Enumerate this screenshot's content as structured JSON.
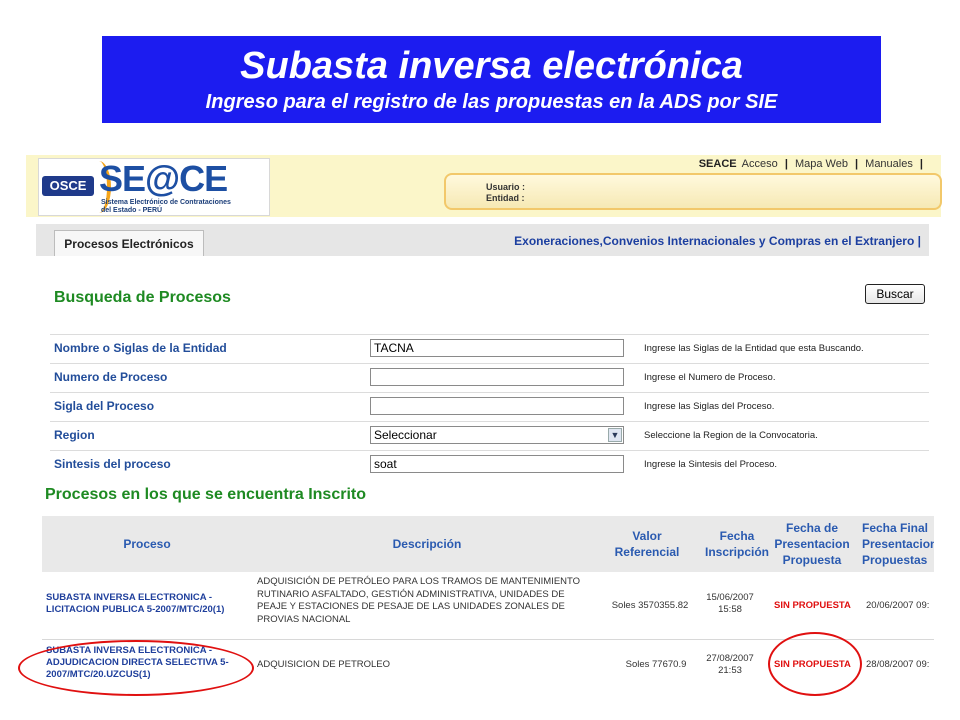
{
  "banner": {
    "title": "Subasta inversa electrónica",
    "subtitle": "Ingreso para el registro de las propuestas en la ADS por SIE"
  },
  "header": {
    "logo_osce": "OSCE",
    "logo_main": "SE@CE",
    "logo_sub_line1": "Sistema Electrónico de Contrataciones",
    "logo_sub_line2": "del Estado - PERÚ",
    "top_links": {
      "seace": "SEACE",
      "acceso": "Acceso",
      "mapa": "Mapa Web",
      "manuales": "Manuales",
      "sep": "|"
    },
    "usuario_label": "Usuario :",
    "entidad_label": "Entidad :"
  },
  "tabs": {
    "active": "Procesos Electrónicos",
    "right_link": "Exoneraciones,Convenios Internacionales y Compras en el Extranjero |"
  },
  "search": {
    "title": "Busqueda de Procesos",
    "button": "Buscar",
    "rows": [
      {
        "label": "Nombre o Siglas de la Entidad",
        "value": "TACNA",
        "help": "Ingrese las Siglas de la Entidad que esta Buscando."
      },
      {
        "label": "Numero de Proceso",
        "value": "",
        "help": "Ingrese el Numero de Proceso."
      },
      {
        "label": "Sigla del Proceso",
        "value": "",
        "help": "Ingrese las Siglas del Proceso."
      },
      {
        "label": "Region",
        "value": "Seleccionar",
        "help": "Seleccione la Region de la Convocatoria."
      },
      {
        "label": "Sintesis del proceso",
        "value": "soat",
        "help": "Ingrese la Sintesis del Proceso."
      }
    ]
  },
  "inscritos": {
    "title": "Procesos en los que se encuentra Inscrito",
    "headers": {
      "proceso": "Proceso",
      "descripcion": "Descripción",
      "valor": [
        "Valor",
        "Referencial"
      ],
      "fecha_insc": [
        "Fecha",
        "Inscripción"
      ],
      "fecha_pres": [
        "Fecha de",
        "Presentacion",
        "Propuesta"
      ],
      "fecha_final": [
        "Fecha Final",
        "Presentacion",
        "Propuestas"
      ]
    },
    "rows": [
      {
        "proceso": [
          "SUBASTA INVERSA ELECTRONICA -",
          "LICITACION PUBLICA 5-2007/MTC/20(1)"
        ],
        "descripcion": [
          "ADQUISICIÓN DE PETRÓLEO PARA LOS TRAMOS DE MANTENIMIENTO",
          "RUTINARIO ASFALTADO, GESTIÓN ADMINISTRATIVA, UNIDADES DE",
          "PEAJE Y ESTACIONES DE PESAJE DE LAS UNIDADES ZONALES DE",
          "PROVIAS NACIONAL"
        ],
        "valor": "Soles 3570355.82",
        "fecha_insc": [
          "15/06/2007",
          "15:58"
        ],
        "estado": "SIN PROPUESTA",
        "fecha_final": "20/06/2007 09:"
      },
      {
        "proceso": [
          "SUBASTA INVERSA ELECTRONICA -",
          "ADJUDICACION DIRECTA SELECTIVA 5-",
          "2007/MTC/20.UZCUS(1)"
        ],
        "descripcion": [
          "ADQUISICION DE PETROLEO"
        ],
        "valor": "Soles 77670.9",
        "fecha_insc": [
          "27/08/2007",
          "21:53"
        ],
        "estado": "SIN PROPUESTA",
        "fecha_final": "28/08/2007 09:"
      }
    ]
  },
  "colors": {
    "banner": "#1c1cf0",
    "green_title": "#1e8a22",
    "link_blue": "#1f3f9c",
    "alert_red": "#e01010"
  }
}
